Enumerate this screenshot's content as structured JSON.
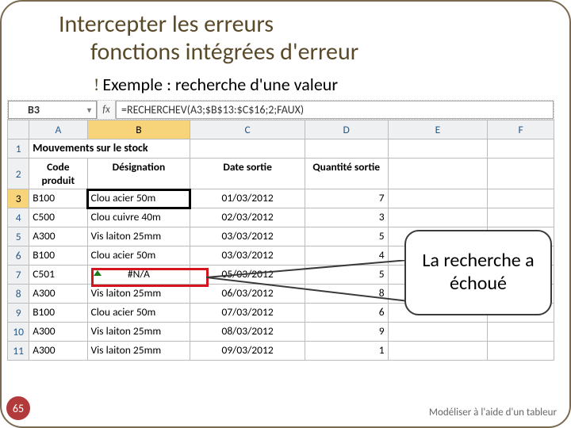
{
  "title_line1": "Intercepter les erreurs",
  "title_line2": "fonctions intégrées d'erreur",
  "subtitle": "Exemple : recherche d'une valeur",
  "formula_bar": {
    "cell_ref": "B3",
    "fx_label": "fx",
    "formula": "=RECHERCHEV(A3;$B$13:$C$16;2;FAUX)"
  },
  "columns": [
    "A",
    "B",
    "C",
    "D",
    "E",
    "F"
  ],
  "sheet_title": "Mouvements sur le stock",
  "headers": {
    "A": "Code produit",
    "B": "Désignation",
    "C": "Date sortie",
    "D": "Quantité sortie"
  },
  "rows": [
    {
      "n": 3,
      "A": "B100",
      "B": "Clou acier 50m",
      "C": "01/03/2012",
      "D": "7"
    },
    {
      "n": 4,
      "A": "C500",
      "B": "Clou cuivre 40m",
      "C": "02/03/2012",
      "D": "3"
    },
    {
      "n": 5,
      "A": "A300",
      "B": "Vis laiton 25mm",
      "C": "03/03/2012",
      "D": "5"
    },
    {
      "n": 6,
      "A": "B100",
      "B": "Clou acier 50m",
      "C": "03/03/2012",
      "D": "4"
    },
    {
      "n": 7,
      "A": "C501",
      "B": "#N/A",
      "C": "05/03/2012",
      "D": "5"
    },
    {
      "n": 8,
      "A": "A300",
      "B": "Vis laiton 25mm",
      "C": "06/03/2012",
      "D": "8"
    },
    {
      "n": 9,
      "A": "B100",
      "B": "Clou acier 50m",
      "C": "07/03/2012",
      "D": "6"
    },
    {
      "n": 10,
      "A": "A300",
      "B": "Vis laiton 25mm",
      "C": "08/03/2012",
      "D": "9"
    },
    {
      "n": 11,
      "A": "A300",
      "B": "Vis laiton 25mm",
      "C": "09/03/2012",
      "D": "1"
    }
  ],
  "callout_text": "La recherche a échoué",
  "footer_text": "Modéliser à l'aide d'un tableur",
  "page_number": "65"
}
